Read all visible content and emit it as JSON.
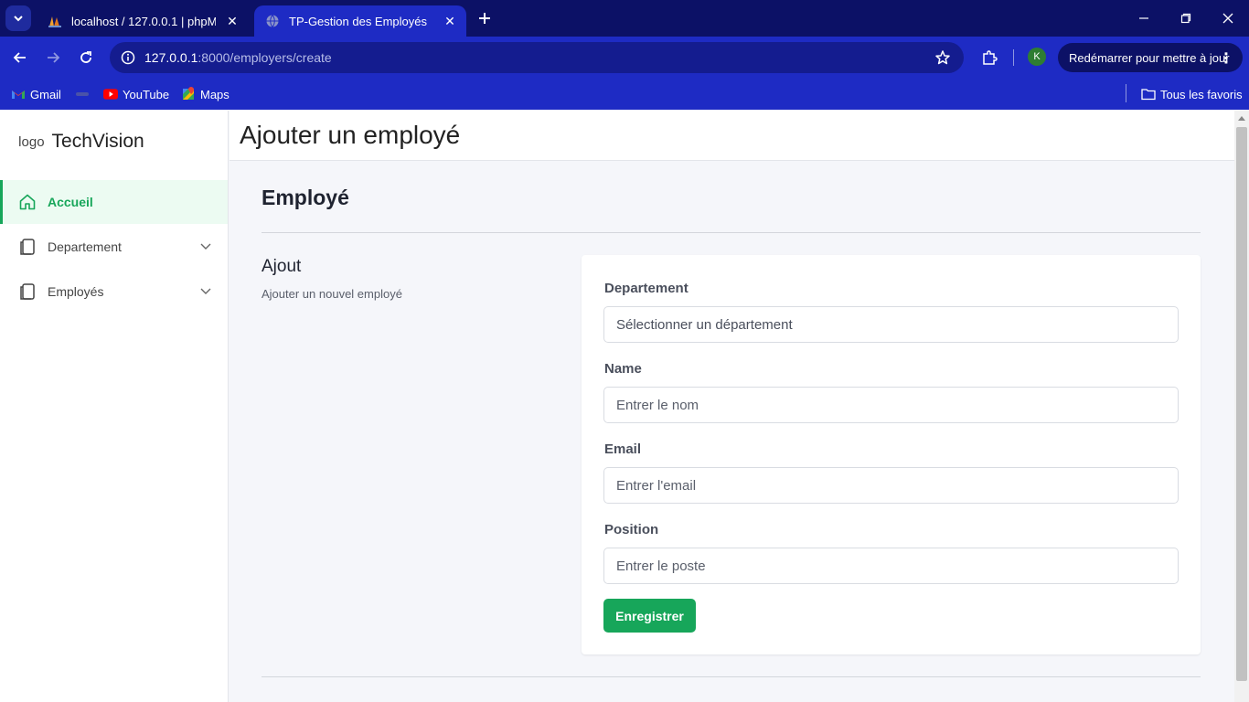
{
  "browser": {
    "tabs": [
      {
        "title": "localhost / 127.0.0.1 | phpMyAdmin",
        "active": false
      },
      {
        "title": "TP-Gestion des Employés",
        "active": true
      }
    ],
    "url_host": "127.0.0.1",
    "url_rest": ":8000/employers/create",
    "profile_initial": "K",
    "update_label": "Redémarrer pour mettre à jour",
    "bookmarks": [
      "Gmail",
      "YouTube",
      "Maps"
    ],
    "all_bookmarks_label": "Tous les favoris"
  },
  "sidebar": {
    "logo_alt": "logo",
    "brand": "TechVision",
    "items": [
      {
        "label": "Accueil",
        "active": true
      },
      {
        "label": "Departement",
        "active": false
      },
      {
        "label": "Employés",
        "active": false
      }
    ]
  },
  "header": {
    "title": "Ajouter un employé"
  },
  "main": {
    "section_title": "Employé",
    "sub_title": "Ajout",
    "sub_description": "Ajouter un nouvel employé",
    "form": {
      "departement_label": "Departement",
      "departement_value": "Sélectionner un département",
      "name_label": "Name",
      "name_placeholder": "Entrer le nom",
      "email_label": "Email",
      "email_placeholder": "Entrer l'email",
      "position_label": "Position",
      "position_placeholder": "Entrer le poste",
      "submit_label": "Enregistrer"
    }
  },
  "colors": {
    "accent": "#17a65a",
    "chrome_dark": "#0c1166",
    "chrome": "#1e2bc4"
  }
}
